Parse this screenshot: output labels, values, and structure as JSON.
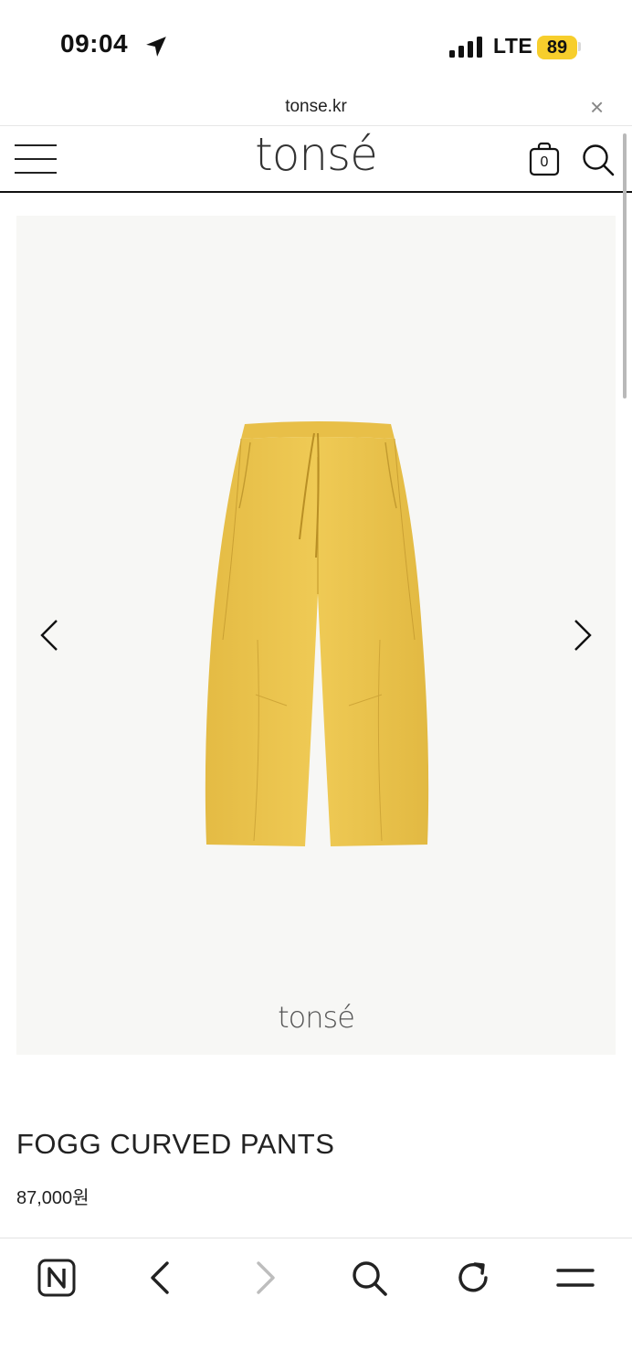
{
  "status_bar": {
    "time": "09:04",
    "network": "LTE",
    "battery": "89"
  },
  "browser": {
    "url": "tonse.kr",
    "close_glyph": "×"
  },
  "header": {
    "logo": "tonsé",
    "cart_count": "0"
  },
  "gallery": {
    "watermark": "tonsé",
    "product_color": "#ecc64f"
  },
  "product": {
    "name": "FOGG CURVED PANTS",
    "price": "87,000원"
  },
  "icons": {
    "menu": "hamburger-menu-icon",
    "cart": "shopping-bag-icon",
    "search": "search-icon",
    "prev": "chevron-left-icon",
    "next": "chevron-right-icon",
    "naver": "naver-n-icon",
    "back": "back-icon",
    "forward": "forward-icon",
    "reload": "reload-icon",
    "more": "more-menu-icon"
  },
  "colors": {
    "battery": "#f7ce2c",
    "gallery_bg": "#f7f7f5",
    "text": "#222222"
  }
}
